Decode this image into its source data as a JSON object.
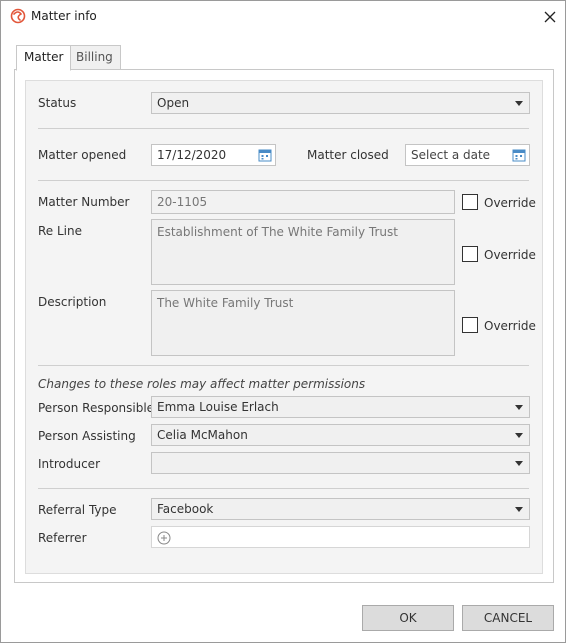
{
  "window": {
    "title": "Matter info"
  },
  "tabs": [
    {
      "label": "Matter"
    },
    {
      "label": "Billing"
    }
  ],
  "form": {
    "status": {
      "label": "Status",
      "value": "Open"
    },
    "matter_opened": {
      "label": "Matter opened",
      "value": "17/12/2020"
    },
    "matter_closed": {
      "label": "Matter closed",
      "placeholder": "Select a date"
    },
    "matter_number": {
      "label": "Matter Number",
      "value": "20-1105",
      "override_label": "Override"
    },
    "re_line": {
      "label": "Re Line",
      "value": "Establishment of The White Family Trust",
      "override_label": "Override"
    },
    "description": {
      "label": "Description",
      "value": "The White Family Trust",
      "override_label": "Override"
    },
    "roles_note": "Changes to these roles may affect matter permissions",
    "person_responsible": {
      "label": "Person Responsible",
      "value": "Emma Louise Erlach"
    },
    "person_assisting": {
      "label": "Person Assisting",
      "value": "Celia McMahon"
    },
    "introducer": {
      "label": "Introducer",
      "value": ""
    },
    "referral_type": {
      "label": "Referral Type",
      "value": "Facebook"
    },
    "referrer": {
      "label": "Referrer"
    }
  },
  "buttons": {
    "ok": "OK",
    "cancel": "CANCEL"
  },
  "colors": {
    "app_icon": "#e2563a",
    "divider": "#cfcfcf"
  }
}
